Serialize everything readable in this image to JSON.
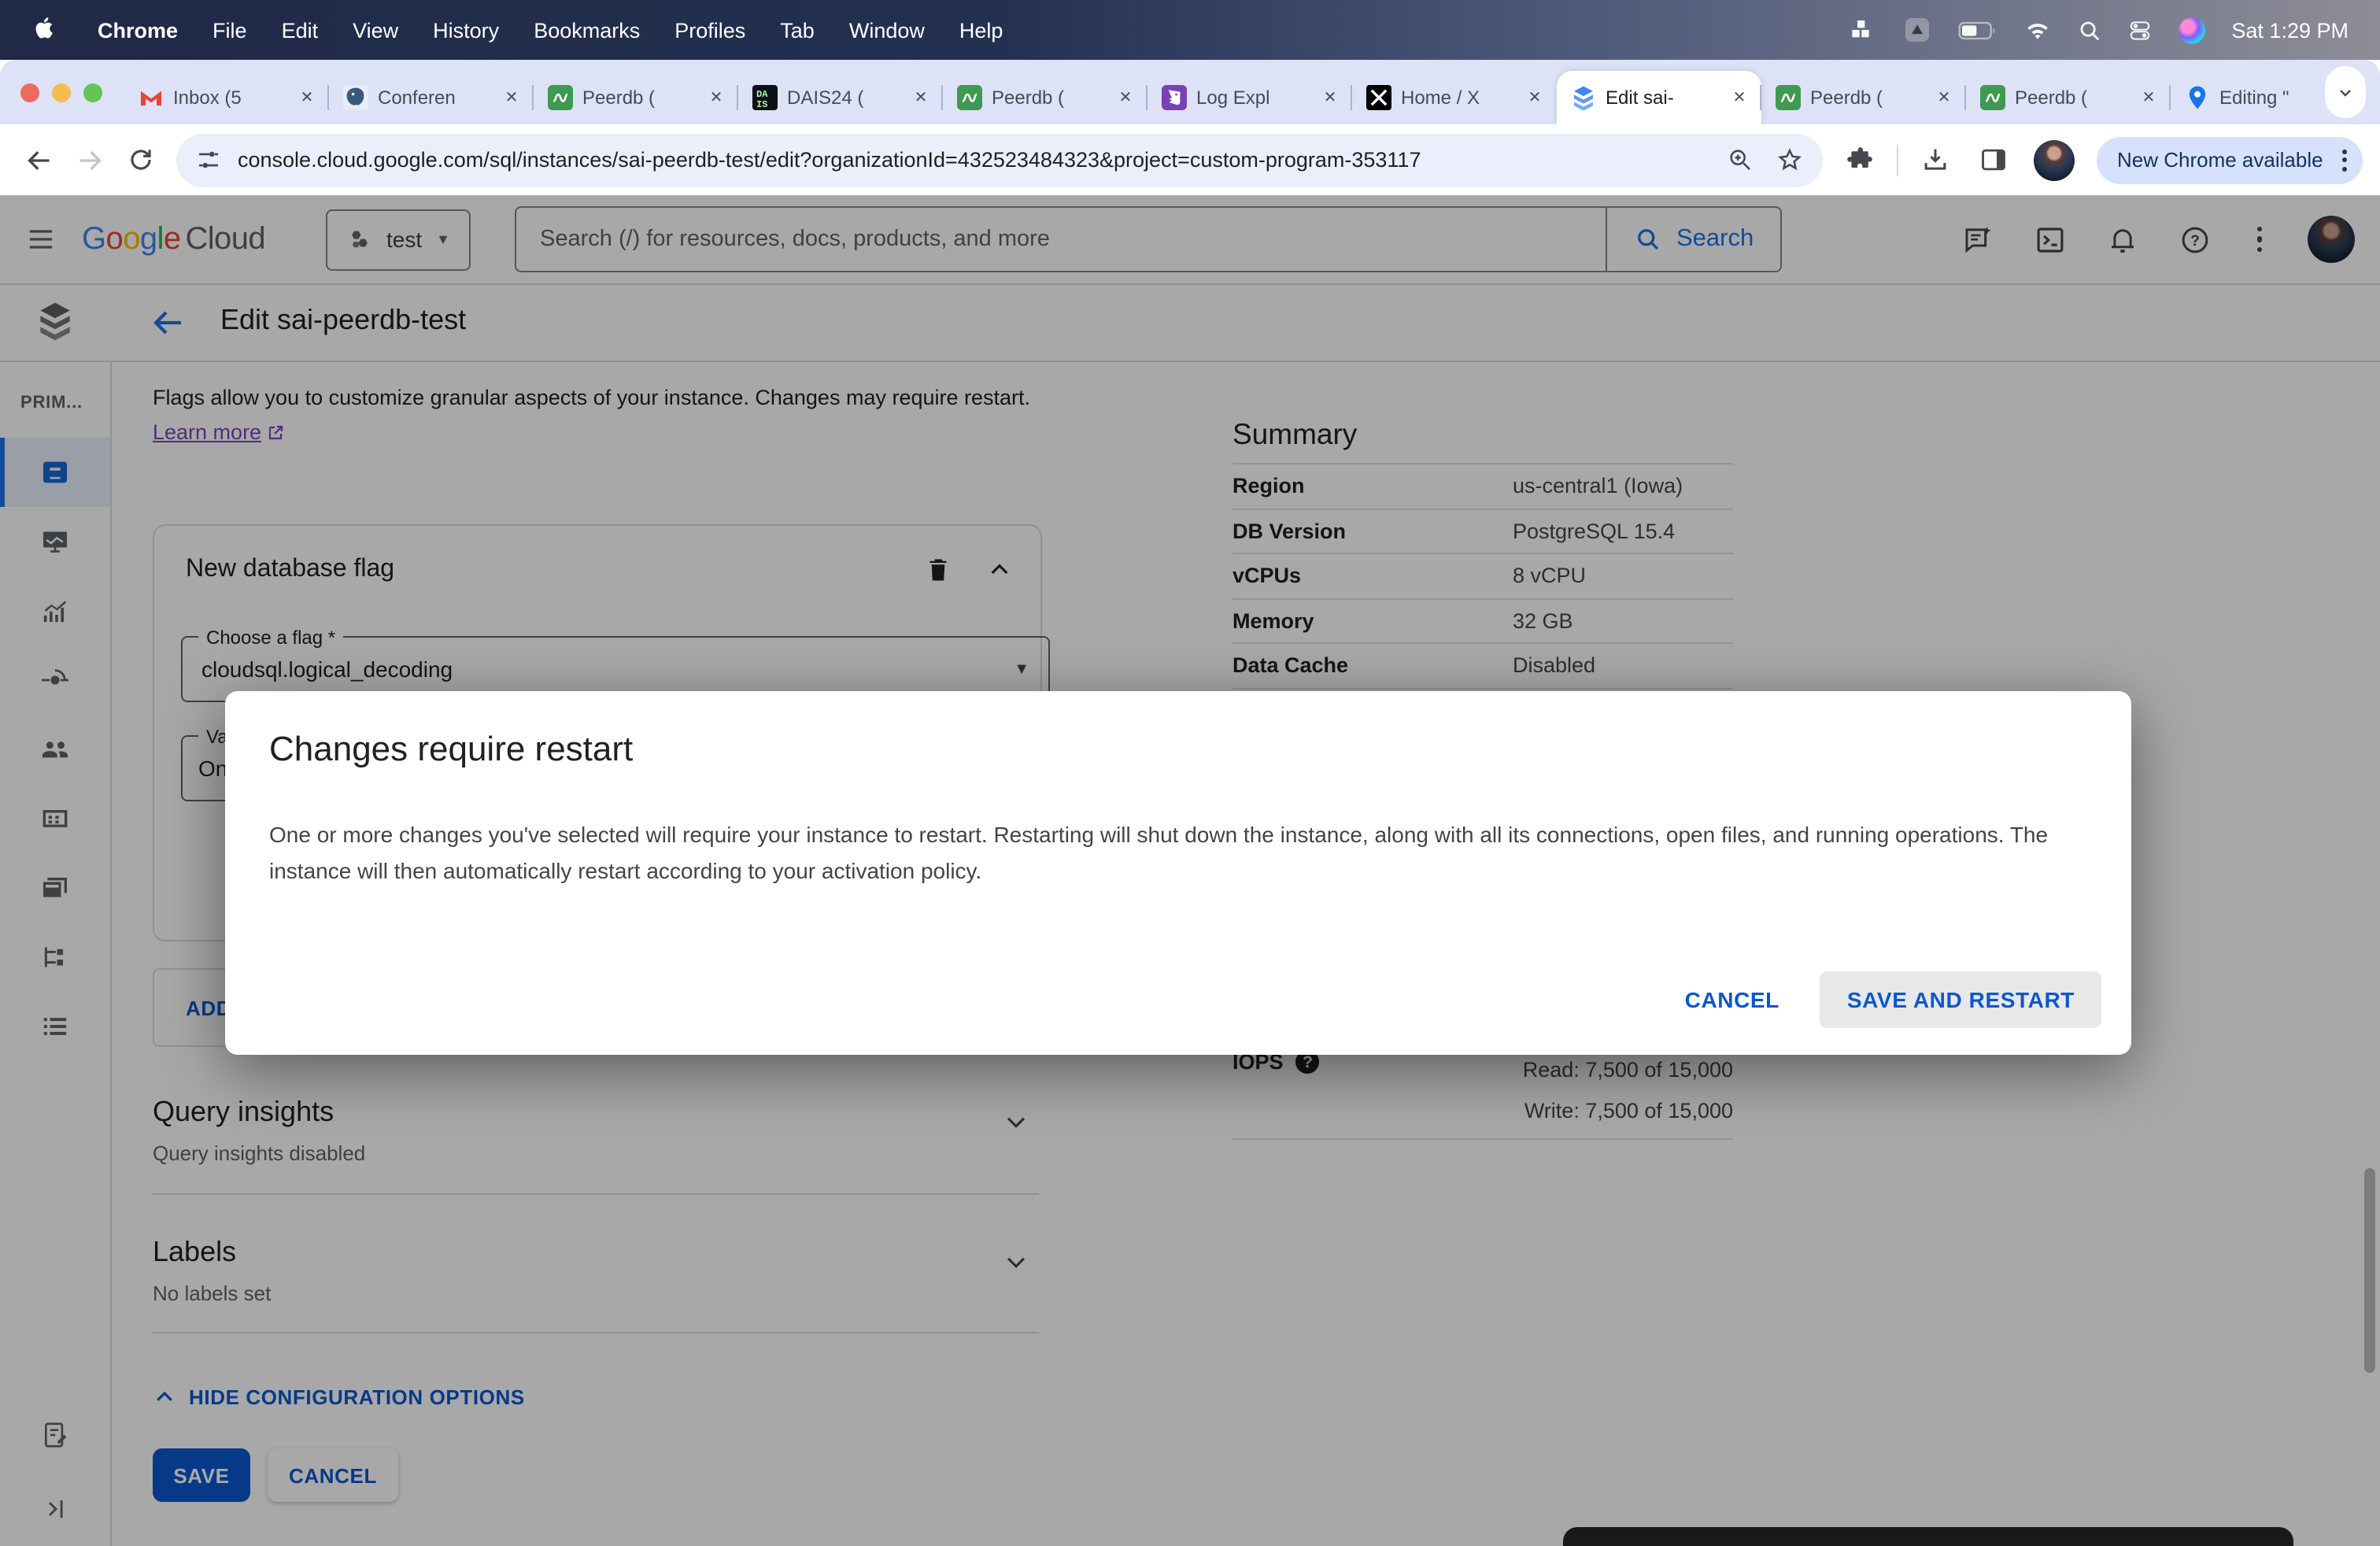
{
  "menubar": {
    "items": [
      "Chrome",
      "File",
      "Edit",
      "View",
      "History",
      "Bookmarks",
      "Profiles",
      "Tab",
      "Window",
      "Help"
    ],
    "status_icons": [
      "grid-icon",
      "app-icon",
      "battery-icon",
      "wifi-icon",
      "search-icon",
      "control-center-icon",
      "siri-icon"
    ],
    "time": "Sat 1:29 PM"
  },
  "tabs": [
    {
      "title": "Inbox (5",
      "icon": "gmail",
      "active": false
    },
    {
      "title": "Conferen",
      "icon": "postgres",
      "active": false
    },
    {
      "title": "Peerdb (",
      "icon": "peerdb",
      "active": false
    },
    {
      "title": "DAIS24 (",
      "icon": "dais",
      "active": false
    },
    {
      "title": "Peerdb (",
      "icon": "peerdb",
      "active": false
    },
    {
      "title": "Log Expl",
      "icon": "datadog",
      "active": false
    },
    {
      "title": "Home / X",
      "icon": "xcorp",
      "active": false
    },
    {
      "title": "Edit sai-",
      "icon": "cloudsql",
      "active": true
    },
    {
      "title": "Peerdb (",
      "icon": "peerdb",
      "active": false
    },
    {
      "title": "Peerdb (",
      "icon": "peerdb",
      "active": false
    },
    {
      "title": "Editing \"",
      "icon": "mappin",
      "active": false
    }
  ],
  "toolbar": {
    "url": "console.cloud.google.com/sql/instances/sai-peerdb-test/edit?organizationId=432523484323&project=custom-program-353117",
    "new_chrome": "New Chrome available"
  },
  "gc_header": {
    "project": "test",
    "search_placeholder": "Search (/) for resources, docs, products, and more",
    "search_button": "Search"
  },
  "page_header": {
    "title": "Edit sai-peerdb-test"
  },
  "sidebar": {
    "section": "PRIM...",
    "items": [
      {
        "icon": "overview",
        "selected": true
      },
      {
        "icon": "monitoring",
        "selected": false
      },
      {
        "icon": "insights",
        "selected": false
      },
      {
        "icon": "connections",
        "selected": false
      },
      {
        "icon": "users",
        "selected": false
      },
      {
        "icon": "databases",
        "selected": false
      },
      {
        "icon": "backups",
        "selected": false
      },
      {
        "icon": "replicas",
        "selected": false
      },
      {
        "icon": "operations",
        "selected": false
      }
    ]
  },
  "flags": {
    "intro": "Flags allow you to customize granular aspects of your instance. Changes may require restart.",
    "learn_more": "Learn more"
  },
  "flag_card": {
    "title": "New database flag",
    "flag_label": "Choose a flag *",
    "flag_value": "cloudsql.logical_decoding",
    "value_label_partial": "Val",
    "value_partial": "On",
    "add_label": "ADD"
  },
  "sections": {
    "query_insights_title": "Query insights",
    "query_insights_sub": "Query insights disabled",
    "labels_title": "Labels",
    "labels_sub": "No labels set"
  },
  "footer": {
    "hide_options": "HIDE CONFIGURATION OPTIONS",
    "save": "SAVE",
    "cancel": "CANCEL"
  },
  "summary": {
    "title": "Summary",
    "rows": [
      {
        "label": "Region",
        "value": "us-central1 (Iowa)"
      },
      {
        "label": "DB Version",
        "value": "PostgreSQL 15.4"
      },
      {
        "label": "vCPUs",
        "value": "8 vCPU"
      },
      {
        "label": "Memory",
        "value": "32 GB"
      },
      {
        "label": "Data Cache",
        "value": "Disabled"
      }
    ],
    "iops_label": "IOPS",
    "iops_read": "Read: 7,500 of 15,000",
    "iops_write": "Write: 7,500 of 15,000"
  },
  "modal": {
    "title": "Changes require restart",
    "body": "One or more changes you've selected will require your instance to restart. Restarting will shut down the instance, along with all its connections, open files, and running operations. The instance will then automatically restart according to your activation policy.",
    "cancel": "CANCEL",
    "save": "SAVE AND RESTART"
  },
  "colors": {
    "accent": "#0b57d0",
    "google_blue": "#1a73e8",
    "scrim": "rgba(0,0,0,0.34)",
    "tabstrip_bg": "#dee2f6"
  }
}
